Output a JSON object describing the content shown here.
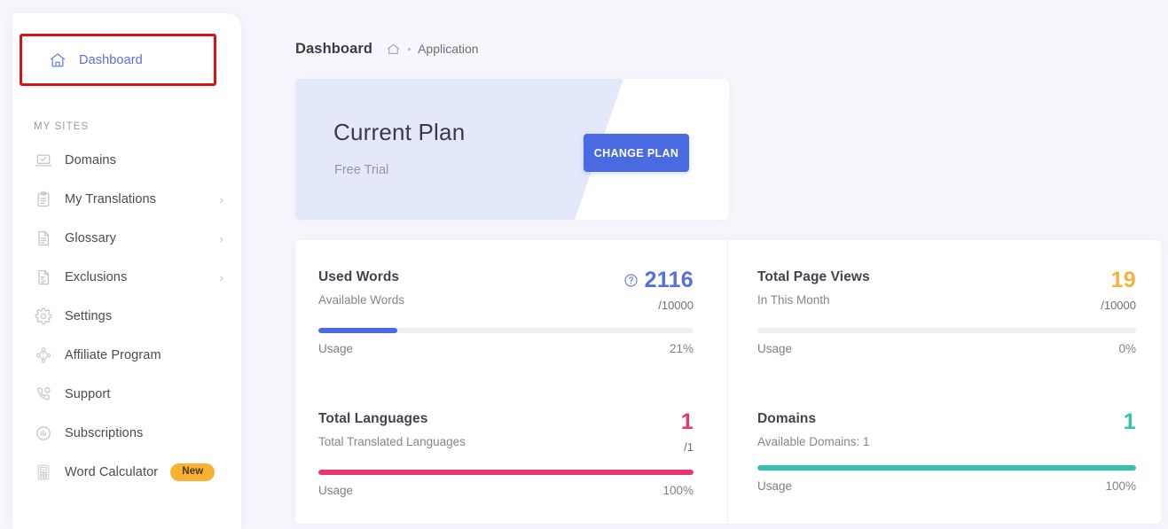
{
  "sidebar": {
    "active_item": {
      "label": "Dashboard",
      "icon": "home-icon"
    },
    "section_label": "MY SITES",
    "items": [
      {
        "label": "Domains",
        "icon": "laptop-check-icon",
        "chevron": false,
        "badge": null
      },
      {
        "label": "My Translations",
        "icon": "clipboard-icon",
        "chevron": true,
        "badge": null
      },
      {
        "label": "Glossary",
        "icon": "document-lines-icon",
        "chevron": true,
        "badge": null
      },
      {
        "label": "Exclusions",
        "icon": "document-check-icon",
        "chevron": true,
        "badge": null
      },
      {
        "label": "Settings",
        "icon": "gear-icon",
        "chevron": false,
        "badge": null
      },
      {
        "label": "Affiliate Program",
        "icon": "network-icon",
        "chevron": false,
        "badge": null
      },
      {
        "label": "Support",
        "icon": "phone-support-icon",
        "chevron": false,
        "badge": null
      },
      {
        "label": "Subscriptions",
        "icon": "chart-circle-icon",
        "chevron": false,
        "badge": null
      },
      {
        "label": "Word Calculator",
        "icon": "calculator-icon",
        "chevron": false,
        "badge": "New"
      }
    ]
  },
  "breadcrumb": {
    "title": "Dashboard",
    "home_icon": "home-outline-icon",
    "link": "Application"
  },
  "plan_card": {
    "title": "Current Plan",
    "subtitle": "Free Trial",
    "button_label": "CHANGE PLAN"
  },
  "stats": [
    {
      "name": "Used Words",
      "description": "Available Words",
      "value": "2116",
      "total": "/10000",
      "usage_label": "Usage",
      "usage_text": "21%",
      "percent": 21,
      "color": "#4a6ae2",
      "help_icon": "question-circle-icon",
      "has_bar": true
    },
    {
      "name": "Total Page Views",
      "description": "In This Month",
      "value": "19",
      "total": "/10000",
      "usage_label": "Usage",
      "usage_text": "0%",
      "percent": 0,
      "color": "#f4b23d",
      "help_icon": null,
      "has_bar": true
    },
    {
      "name": "Total Languages",
      "description": "Total Translated Languages",
      "value": "1",
      "total": "/1",
      "usage_label": "Usage",
      "usage_text": "100%",
      "percent": 100,
      "color": "#e8376f",
      "help_icon": null,
      "has_bar": true
    },
    {
      "name": "Domains",
      "description": "Available Domains: 1",
      "value": "1",
      "total": "",
      "usage_label": "Usage",
      "usage_text": "100%",
      "percent": 100,
      "color": "#35c0b0",
      "help_icon": null,
      "has_bar": true
    }
  ],
  "theme": {
    "accent_blue": "#4a6ae2",
    "page_bg": "#f7f6fc",
    "highlight_border": "#d81217",
    "badge_bg": "#f8b133"
  }
}
